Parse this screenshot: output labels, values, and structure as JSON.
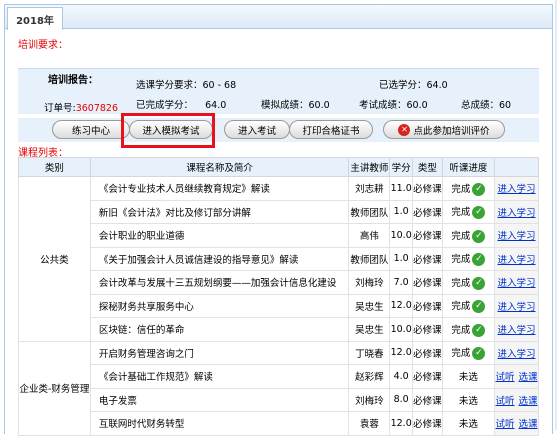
{
  "tab": {
    "label": "2018年"
  },
  "requirements_label": "培训要求：",
  "report": {
    "title": "培训报告：",
    "order_label": "订单号:",
    "order_number": "3607826",
    "required_credits": "选课学分要求：60 - 68",
    "selected_credits": "已选学分：64.0",
    "completed_credits_label": "已完成学分：",
    "completed_credits": "64.0",
    "mock_score": "模拟成绩：60.0",
    "exam_score": "考试成绩：60.0",
    "total_score": "总成绩：60"
  },
  "buttons": {
    "practice": "练习中心",
    "mock_exam": "进入模拟考试",
    "exam": "进入考试",
    "print_cert": "打印合格证书",
    "evaluate": "点此参加培训评价"
  },
  "course_list_label": "课程列表：",
  "table": {
    "headers": [
      "类别",
      "课程名称及简介",
      "主讲教师",
      "学分",
      "类型",
      "听课进度",
      ""
    ],
    "categories": [
      "公共类",
      "企业类-财务管理"
    ],
    "rows": [
      {
        "name": "《会计专业技术人员继续教育规定》解读",
        "teacher": "刘志耕",
        "credit": "11.0",
        "type": "必修课",
        "progress": "完成",
        "done": true,
        "actions": [
          "进入学习"
        ]
      },
      {
        "name": "新旧《会计法》对比及修订部分讲解",
        "teacher": "教师团队",
        "credit": "1.0",
        "type": "必修课",
        "progress": "完成",
        "done": true,
        "actions": [
          "进入学习"
        ]
      },
      {
        "name": "会计职业的职业道德",
        "teacher": "高伟",
        "credit": "10.0",
        "type": "必修课",
        "progress": "完成",
        "done": true,
        "actions": [
          "进入学习"
        ]
      },
      {
        "name": "《关于加强会计人员诚信建设的指导意见》解读",
        "teacher": "教师团队",
        "credit": "1.0",
        "type": "必修课",
        "progress": "完成",
        "done": true,
        "actions": [
          "进入学习"
        ]
      },
      {
        "name": "会计改革与发展十三五规划纲要——加强会计信息化建设",
        "teacher": "刘梅玲",
        "credit": "7.0",
        "type": "必修课",
        "progress": "完成",
        "done": true,
        "actions": [
          "进入学习"
        ]
      },
      {
        "name": "探秘财务共享服务中心",
        "teacher": "吴忠生",
        "credit": "12.0",
        "type": "必修课",
        "progress": "完成",
        "done": true,
        "actions": [
          "进入学习"
        ]
      },
      {
        "name": "区块链：信任的革命",
        "teacher": "吴忠生",
        "credit": "10.0",
        "type": "必修课",
        "progress": "完成",
        "done": true,
        "actions": [
          "进入学习"
        ]
      },
      {
        "name": "开启财务管理咨询之门",
        "teacher": "丁晓春",
        "credit": "12.0",
        "type": "必修课",
        "progress": "完成",
        "done": true,
        "actions": [
          "进入学习"
        ]
      },
      {
        "name": "《会计基础工作规范》解读",
        "teacher": "赵彩辉",
        "credit": "4.0",
        "type": "必修课",
        "progress": "未选",
        "done": false,
        "actions": [
          "试听",
          "选课"
        ]
      },
      {
        "name": "电子发票",
        "teacher": "刘梅玲",
        "credit": "8.0",
        "type": "必修课",
        "progress": "未选",
        "done": false,
        "actions": [
          "试听",
          "选课"
        ]
      },
      {
        "name": "互联网时代财务转型",
        "teacher": "袁蓉",
        "credit": "12.0",
        "type": "必修课",
        "progress": "未选",
        "done": false,
        "actions": [
          "试听",
          "选课"
        ]
      }
    ]
  },
  "colors": {
    "accent_red": "#e60000",
    "link_blue": "#0033cc",
    "header_bg": "#e6f1fb",
    "check_green": "#3aa335"
  },
  "icons": {
    "done": "check-circle-icon",
    "evaluate": "x-circle-icon"
  }
}
